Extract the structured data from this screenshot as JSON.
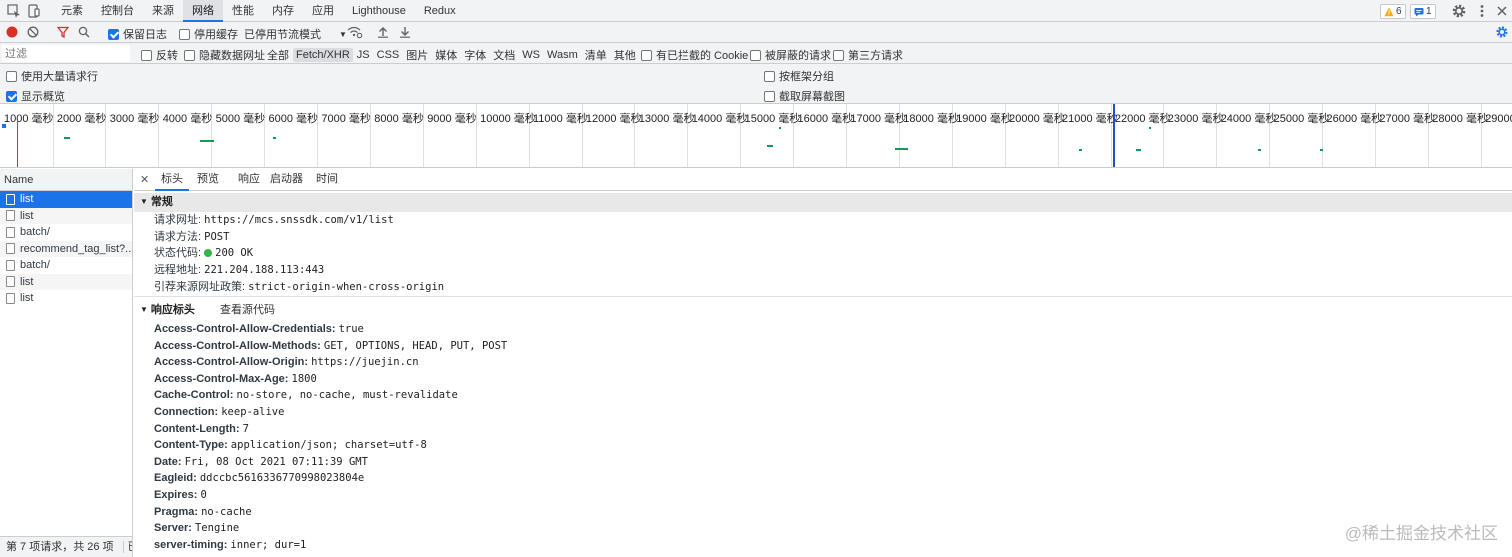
{
  "devtools_tabs": [
    "元素",
    "控制台",
    "来源",
    "网络",
    "性能",
    "内存",
    "应用",
    "Lighthouse",
    "Redux"
  ],
  "active_tab_index": 3,
  "badges": {
    "warnings": "6",
    "messages": "1"
  },
  "toolbar": {
    "preserve_log": "保留日志",
    "disable_cache": "停用缓存",
    "throttle": "已停用节流模式"
  },
  "filter": {
    "placeholder": "过滤",
    "invert": "反转",
    "hide_data_urls": "隐藏数据网址",
    "types": [
      "全部",
      "Fetch/XHR",
      "JS",
      "CSS",
      "图片",
      "媒体",
      "字体",
      "文档",
      "WS",
      "Wasm",
      "清单",
      "其他"
    ],
    "selected_type": "Fetch/XHR",
    "blocked_cookies": "有已拦截的 Cookie",
    "blocked_requests": "被屏蔽的请求",
    "third_party": "第三方请求"
  },
  "options": {
    "large_rows": "使用大量请求行",
    "group_by_frame": "按框架分组",
    "show_overview": "显示概览",
    "capture_screenshots": "截取屏幕截图"
  },
  "timeline_ticks": [
    "1000 毫秒",
    "2000 毫秒",
    "3000 毫秒",
    "4000 毫秒",
    "5000 毫秒",
    "6000 毫秒",
    "7000 毫秒",
    "8000 毫秒",
    "9000 毫秒",
    "10000 毫秒",
    "11000 毫秒",
    "12000 毫秒",
    "13000 毫秒",
    "14000 毫秒",
    "15000 毫秒",
    "16000 毫秒",
    "17000 毫秒",
    "18000 毫秒",
    "19000 毫秒",
    "20000 毫秒",
    "21000 毫秒",
    "22000 毫秒",
    "23000 毫秒",
    "24000 毫秒",
    "25000 毫秒",
    "26000 毫秒",
    "27000 毫秒",
    "28000 毫秒",
    "29000 毫"
  ],
  "request_list": {
    "header": "Name",
    "items": [
      "list",
      "list",
      "batch/",
      "recommend_tag_list?...",
      "batch/",
      "list",
      "list"
    ],
    "selected_index": 0,
    "status": "第 7 项请求，共 26 项",
    "status_tail": "已"
  },
  "detail_tabs": [
    "标头",
    "预览",
    "响应",
    "启动器",
    "时间"
  ],
  "active_detail_tab": 0,
  "general": {
    "title": "常规",
    "rows": [
      {
        "key": "请求网址:",
        "value": "https://mcs.snssdk.com/v1/list"
      },
      {
        "key": "请求方法:",
        "value": "POST"
      },
      {
        "key": "状态代码:",
        "value": "200 OK"
      },
      {
        "key": "远程地址:",
        "value": "221.204.188.113:443"
      },
      {
        "key": "引荐来源网址政策:",
        "value": "strict-origin-when-cross-origin"
      }
    ]
  },
  "response_headers": {
    "title": "响应标头",
    "view_source": "查看源代码",
    "rows": [
      {
        "key": "Access-Control-Allow-Credentials:",
        "value": "true"
      },
      {
        "key": "Access-Control-Allow-Methods:",
        "value": "GET, OPTIONS, HEAD, PUT, POST"
      },
      {
        "key": "Access-Control-Allow-Origin:",
        "value": "https://juejin.cn"
      },
      {
        "key": "Access-Control-Max-Age:",
        "value": "1800"
      },
      {
        "key": "Cache-Control:",
        "value": "no-store, no-cache, must-revalidate"
      },
      {
        "key": "Connection:",
        "value": "keep-alive"
      },
      {
        "key": "Content-Length:",
        "value": "7"
      },
      {
        "key": "Content-Type:",
        "value": "application/json; charset=utf-8"
      },
      {
        "key": "Date:",
        "value": "Fri, 08 Oct 2021 07:11:39 GMT"
      },
      {
        "key": "Eagleid:",
        "value": "ddccbc5616336770998023804e"
      },
      {
        "key": "Expires:",
        "value": "0"
      },
      {
        "key": "Pragma:",
        "value": "no-cache"
      },
      {
        "key": "Server:",
        "value": "Tengine"
      },
      {
        "key": "server-timing:",
        "value": "inner; dur=1"
      }
    ]
  },
  "watermark": "@稀土掘金技术社区",
  "colors": {
    "accent": "#1a73e8",
    "record": "#d93025",
    "status_ok": "#2db944"
  }
}
